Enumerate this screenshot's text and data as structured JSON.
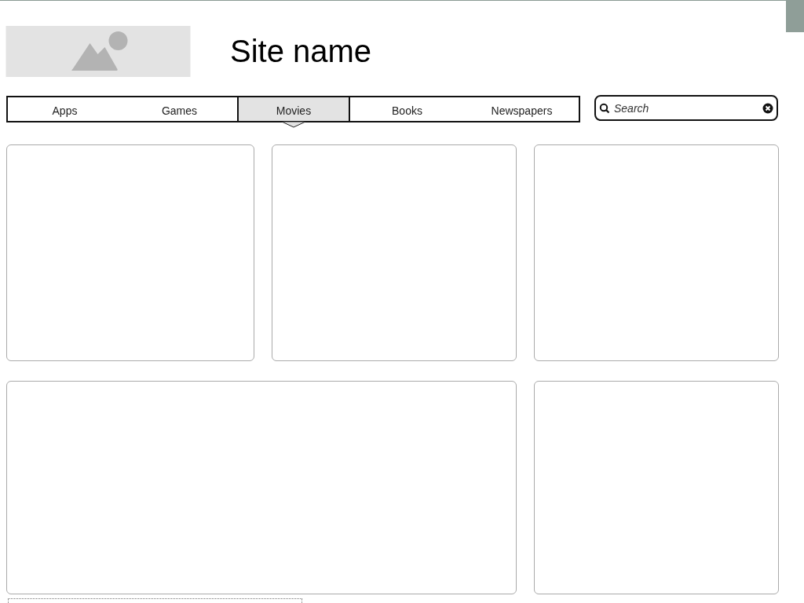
{
  "header": {
    "site_name": "Site name"
  },
  "tabs": [
    {
      "label": "Apps",
      "selected": false
    },
    {
      "label": "Games",
      "selected": false
    },
    {
      "label": "Movies",
      "selected": true
    },
    {
      "label": "Books",
      "selected": false
    },
    {
      "label": "Newspapers",
      "selected": false
    }
  ],
  "search": {
    "placeholder": "Search"
  }
}
